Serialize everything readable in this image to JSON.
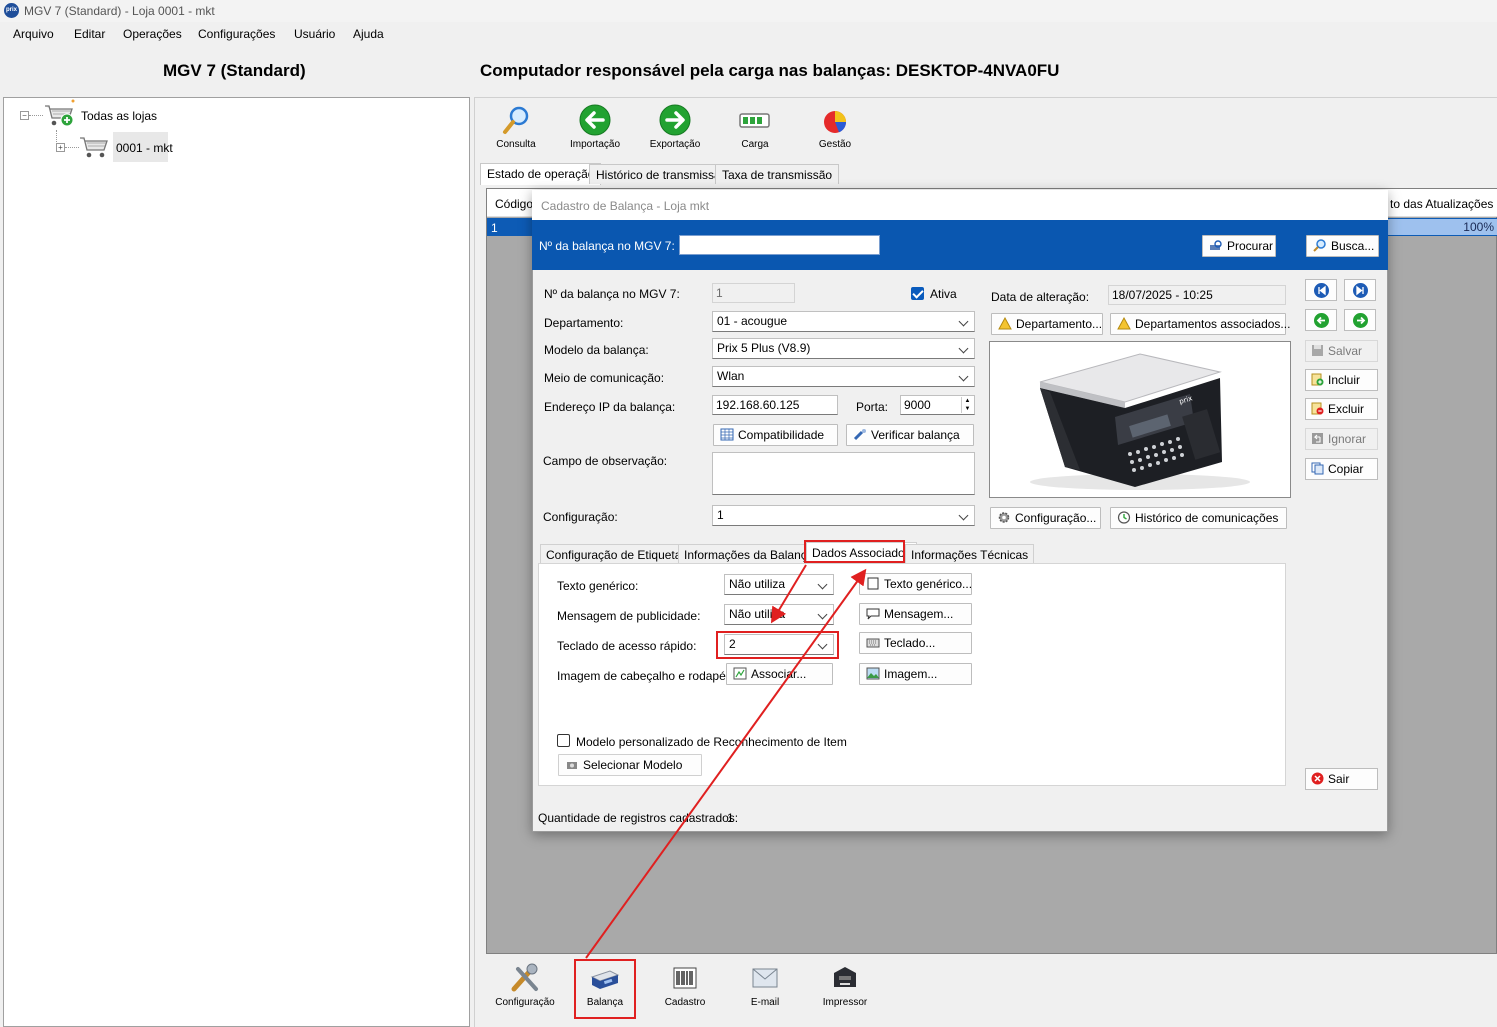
{
  "window": {
    "title": "MGV 7 (Standard) - Loja 0001 - mkt",
    "logo": "prix"
  },
  "menu": [
    "Arquivo",
    "Editar",
    "Operações",
    "Configurações",
    "Usuário",
    "Ajuda"
  ],
  "header": {
    "left": "MGV 7 (Standard)",
    "right": "Computador responsável pela carga nas balanças: DESKTOP-4NVA0FU"
  },
  "tree": {
    "root": "Todas as lojas",
    "child": "0001 - mkt"
  },
  "toolbar": [
    "Consulta",
    "Importação",
    "Exportação",
    "Carga",
    "Gestão"
  ],
  "main_tabs": [
    "Estado de operação",
    "Histórico de transmissão",
    "Taxa de transmissão"
  ],
  "grid": {
    "col_first": "Código",
    "col_last": "to das Atualizações",
    "row_first": "1",
    "row_pct": "100%"
  },
  "dialog": {
    "title": "Cadastro de Balança - Loja mkt",
    "search_label": "Nº da balança no MGV 7:",
    "search_value": "",
    "btn_procurar": "Procurar",
    "btn_busca": "Busca...",
    "num_label": "Nº da balança no MGV 7:",
    "num_value": "1",
    "ativa_label": "Ativa",
    "data_alt_label": "Data de alteração:",
    "data_alt_value": "18/07/2025 - 10:25",
    "dept_label": "Departamento:",
    "dept_value": "01 - acougue",
    "btn_departamento": "Departamento...",
    "btn_dept_assoc": "Departamentos associados...",
    "modelo_label": "Modelo da balança:",
    "modelo_value": "Prix 5 Plus (V8.9)",
    "meio_label": "Meio de comunicação:",
    "meio_value": "Wlan",
    "ip_label": "Endereço IP da balança:",
    "ip_value": "192.168.60.125",
    "porta_label": "Porta:",
    "porta_value": "9000",
    "btn_compat": "Compatibilidade",
    "btn_verificar": "Verificar balança",
    "obs_label": "Campo de observação:",
    "obs_value": "",
    "config_label": "Configuração:",
    "config_value": "1",
    "btn_configuracao": "Configuração...",
    "btn_historico": "Histórico de comunicações",
    "side_buttons": [
      "Salvar",
      "Incluir",
      "Excluir",
      "Ignorar",
      "Copiar"
    ],
    "btn_sair": "Sair",
    "sub_tabs": [
      "Configuração de Etiquetas",
      "Informações da Balança",
      "Dados Associados",
      "Informações Técnicas"
    ],
    "texto_label": "Texto genérico:",
    "texto_value": "Não utiliza",
    "btn_texto": "Texto genérico...",
    "msg_label": "Mensagem de publicidade:",
    "msg_value": "Não utiliza",
    "btn_msg": "Mensagem...",
    "teclado_label": "Teclado de acesso rápido:",
    "teclado_value": "2",
    "btn_teclado": "Teclado...",
    "imagem_label": "Imagem de cabeçalho e rodapé:",
    "btn_associar": "Associar...",
    "btn_imagem": "Imagem...",
    "modelo_pers_label": "Modelo personalizado de Reconhecimento de Item",
    "btn_sel_modelo": "Selecionar Modelo",
    "qtd_label": "Quantidade de registros cadastrados:",
    "qtd_value": "1",
    "scale_brand": "prix"
  },
  "bottom_toolbar": [
    "Configuração",
    "Balança",
    "Cadastro",
    "E-mail",
    "Impressor"
  ],
  "colors": {
    "accent_blue": "#0a57b0",
    "annotation_red": "#e02020",
    "green": "#1e9c2e"
  }
}
